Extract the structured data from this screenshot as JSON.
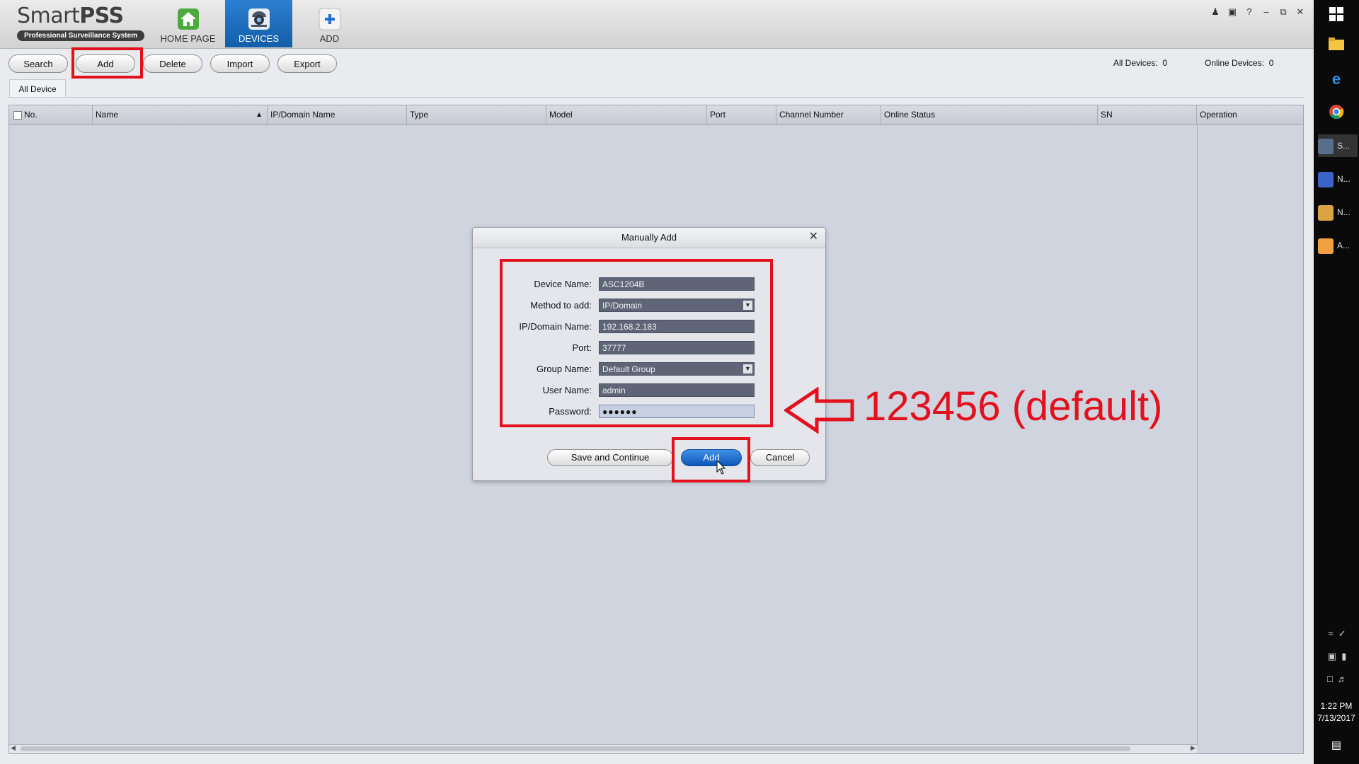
{
  "window": {
    "app_name_light": "Smart",
    "app_name_bold": "PSS",
    "app_subtitle": "Professional Surveillance System"
  },
  "nav": [
    {
      "label": "HOME PAGE",
      "icon": "home-icon",
      "active": false
    },
    {
      "label": "DEVICES",
      "icon": "camera-icon",
      "active": true
    },
    {
      "label": "ADD",
      "icon": "plus-icon",
      "active": false
    }
  ],
  "toolbar": {
    "search": "Search",
    "add": "Add",
    "delete": "Delete",
    "import": "Import",
    "export": "Export"
  },
  "counts": {
    "all_label": "All Devices:",
    "all_value": "0",
    "online_label": "Online Devices:",
    "online_value": "0"
  },
  "tabs": {
    "all_device": "All Device"
  },
  "table": {
    "columns": [
      "No.",
      "Name",
      "IP/Domain Name",
      "Type",
      "Model",
      "Port",
      "Channel Number",
      "Online Status",
      "SN",
      "Operation"
    ]
  },
  "dialog": {
    "title": "Manually Add",
    "fields": {
      "device_name": {
        "label": "Device Name:",
        "value": "ASC1204B"
      },
      "method": {
        "label": "Method to add:",
        "value": "IP/Domain"
      },
      "ip": {
        "label": "IP/Domain Name:",
        "value": "192.168.2.183"
      },
      "port": {
        "label": "Port:",
        "value": "37777"
      },
      "group": {
        "label": "Group Name:",
        "value": "Default Group"
      },
      "user": {
        "label": "User Name:",
        "value": "admin"
      },
      "password": {
        "label": "Password:",
        "value": "●●●●●●"
      }
    },
    "buttons": {
      "save_continue": "Save and Continue",
      "add": "Add",
      "cancel": "Cancel"
    }
  },
  "annotation": {
    "text": "123456 (default)"
  },
  "taskbar": {
    "apps": [
      {
        "label": "S...",
        "color": "#5a6d8a"
      },
      {
        "label": "N...",
        "color": "#3a64c8"
      },
      {
        "label": "N...",
        "color": "#d9a441"
      },
      {
        "label": "A...",
        "color": "#f0a040"
      }
    ],
    "time": "1:22 PM",
    "date": "7/13/2017"
  },
  "colors": {
    "accent": "#145ea8",
    "annotation_red": "#e3101d",
    "input_bg": "#5f6577"
  }
}
